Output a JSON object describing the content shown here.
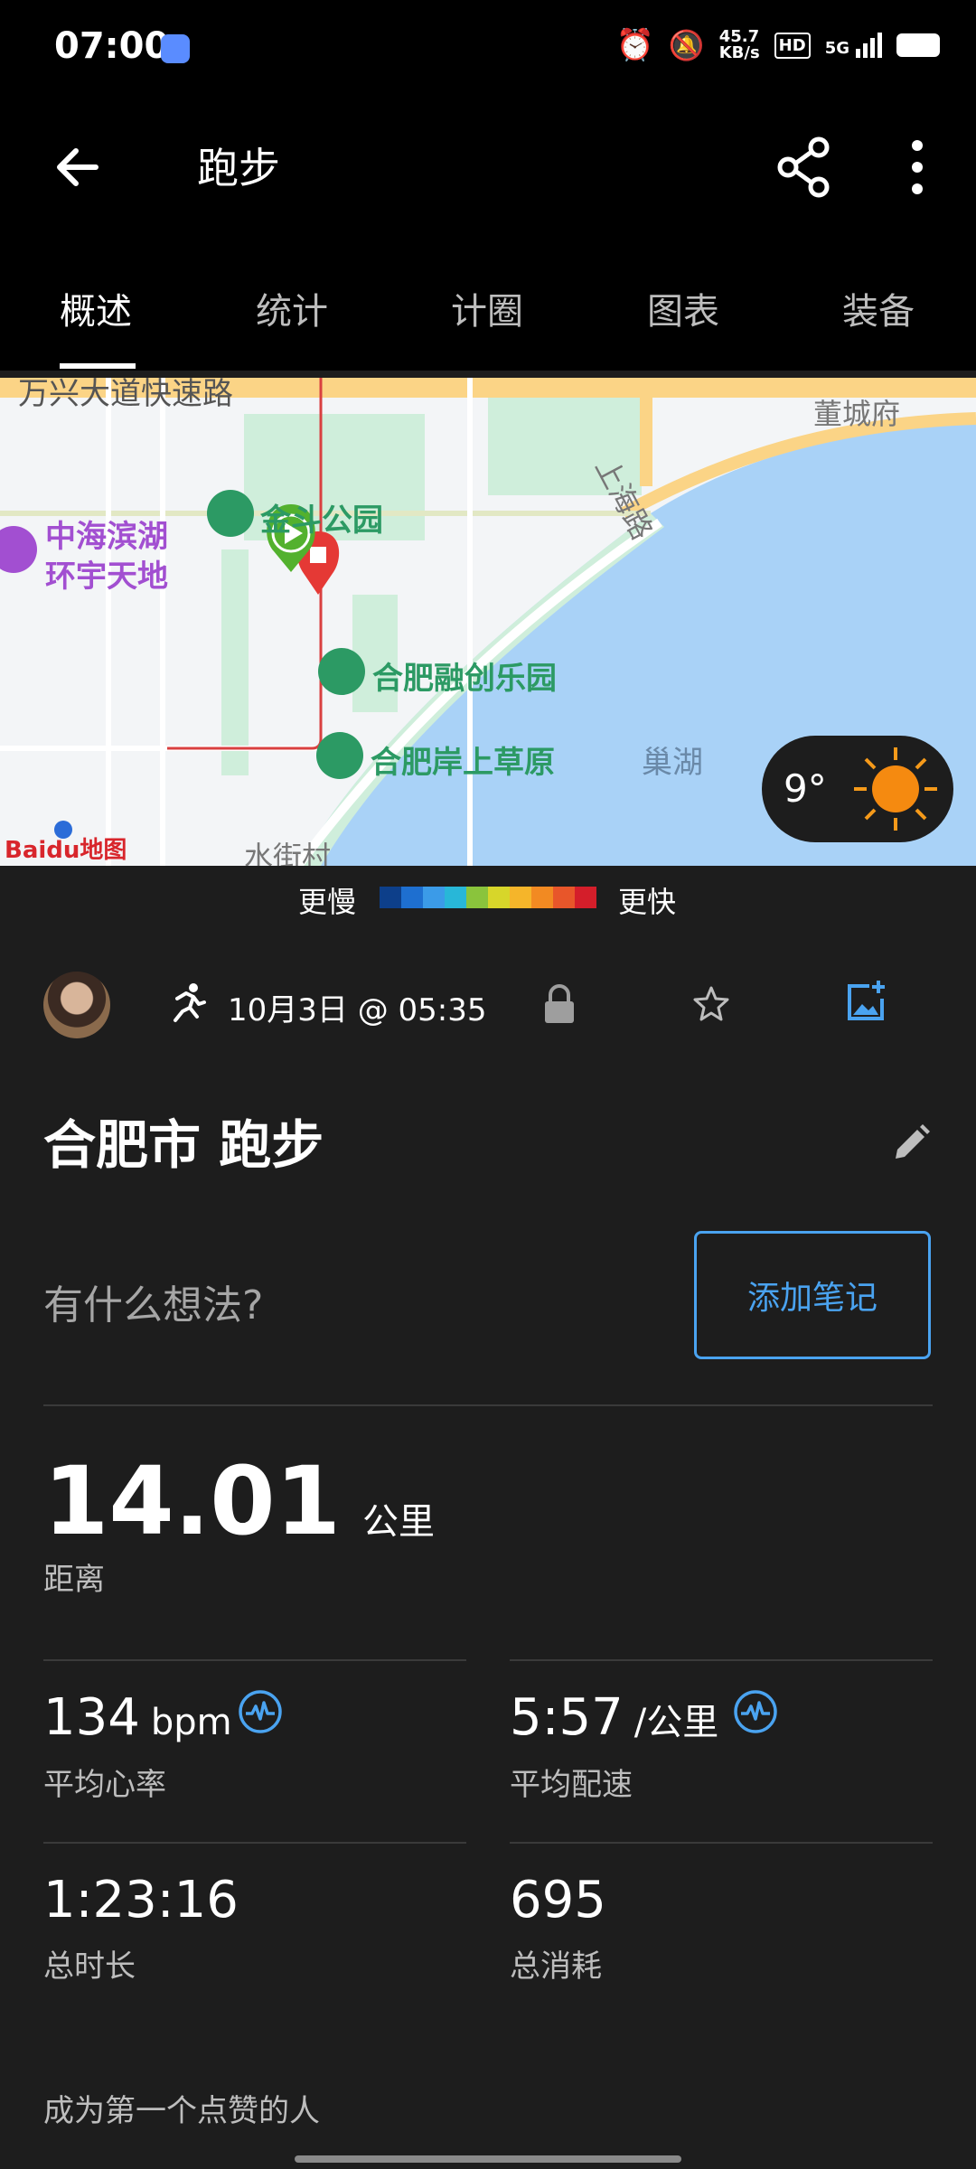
{
  "status_bar": {
    "time": "07:00",
    "net_speed_top": "45.7",
    "net_speed_bottom": "KB/s",
    "hd": "HD",
    "signal": "5G"
  },
  "app_bar": {
    "title": "跑步"
  },
  "tabs": [
    {
      "label": "概述"
    },
    {
      "label": "统计"
    },
    {
      "label": "计圈"
    },
    {
      "label": "图表"
    },
    {
      "label": "装备"
    }
  ],
  "map": {
    "roads": [
      "万兴大道快速路",
      "上海路",
      "董城府"
    ],
    "pois": [
      "中海滨湖",
      "环宇天地",
      "金斗公园",
      "合肥融创乐园",
      "合肥岸上草原",
      "巢湖",
      "水街村"
    ],
    "provider": "Baidu地图",
    "weather": {
      "temp": "9°"
    }
  },
  "legend": {
    "slow": "更慢",
    "fast": "更快",
    "colors": [
      "#0d3f8a",
      "#1e6fd0",
      "#3b9be8",
      "#28b7d8",
      "#8ac43c",
      "#d7d62a",
      "#f5b52a",
      "#f28a22",
      "#e8562a",
      "#d41e2a"
    ]
  },
  "activity": {
    "date": "10月3日 @ 05:35",
    "name": "合肥市 跑步",
    "note_placeholder": "有什么想法?",
    "add_note_label": "添加笔记"
  },
  "stats": {
    "distance": {
      "value": "14.01",
      "unit": "公里",
      "label": "距离"
    },
    "heart_rate": {
      "value": "134",
      "unit": "bpm",
      "label": "平均心率"
    },
    "pace": {
      "value": "5:57",
      "unit": "/公里",
      "label": "平均配速"
    },
    "duration": {
      "value": "1:23:16",
      "label": "总时长"
    },
    "calories": {
      "value": "695",
      "label": "总消耗"
    }
  },
  "kudos_text": "成为第一个点赞的人",
  "colors": {
    "accent": "#4aa3f0",
    "background": "#1d1d1d",
    "map_water": "#a9d2f7",
    "route": "#d94040"
  }
}
